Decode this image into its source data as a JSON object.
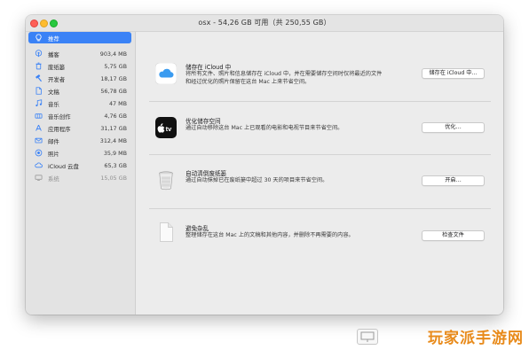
{
  "window": {
    "title": "osx - 54,26 GB 可用（共 250,55 GB）"
  },
  "sidebar": {
    "items": [
      {
        "icon": "lightbulb-icon",
        "label": "推荐",
        "size": "",
        "selected": true
      },
      {
        "icon": "podcast-icon",
        "label": "播客",
        "size": "903,4 MB"
      },
      {
        "icon": "trash-icon",
        "label": "废纸篓",
        "size": "5,75 GB"
      },
      {
        "icon": "hammer-icon",
        "label": "开发者",
        "size": "18,17 GB"
      },
      {
        "icon": "document-icon",
        "label": "文稿",
        "size": "56,78 GB"
      },
      {
        "icon": "music-note-icon",
        "label": "音乐",
        "size": "47 MB"
      },
      {
        "icon": "music-creation-icon",
        "label": "音乐创作",
        "size": "4,76 GB"
      },
      {
        "icon": "app-store-icon",
        "label": "应用程序",
        "size": "31,17 GB"
      },
      {
        "icon": "mail-icon",
        "label": "邮件",
        "size": "312,4 MB"
      },
      {
        "icon": "photos-icon",
        "label": "照片",
        "size": "35,9 MB"
      },
      {
        "icon": "cloud-icon",
        "label": "iCloud 云盘",
        "size": "65,3 GB"
      },
      {
        "icon": "system-icon",
        "label": "系统",
        "size": "15,05 GB",
        "dim": true
      }
    ]
  },
  "sections": [
    {
      "icon": "icloud-icon",
      "title": "储存在 iCloud 中",
      "desc1": "将所有文件、照片和信息储存在 iCloud 中，并在需要储存空间时仅将最近的文件",
      "desc2": "和经过优化的照片保留在这台 Mac 上来节省空间。",
      "button": "储存在 iCloud 中…"
    },
    {
      "icon": "apple-tv-icon",
      "title": "优化储存空间",
      "desc1": "通过自动移除这台 Mac 上已观看的电影和电视节目来节省空间。",
      "button": "优化…"
    },
    {
      "icon": "trash-bin-icon",
      "title": "自动清倒废纸篓",
      "desc1": "通过自动抹掉已在废纸篓中超过 30 天的项目来节省空间。",
      "button": "开启…"
    },
    {
      "icon": "document-file-icon",
      "title": "避免杂乱",
      "desc1": "整理储存在这台 Mac 上的文稿和其他内容，并删除不再需要的内容。",
      "button": "检查文件"
    }
  ],
  "watermark": {
    "text": "玩家派手游网"
  }
}
